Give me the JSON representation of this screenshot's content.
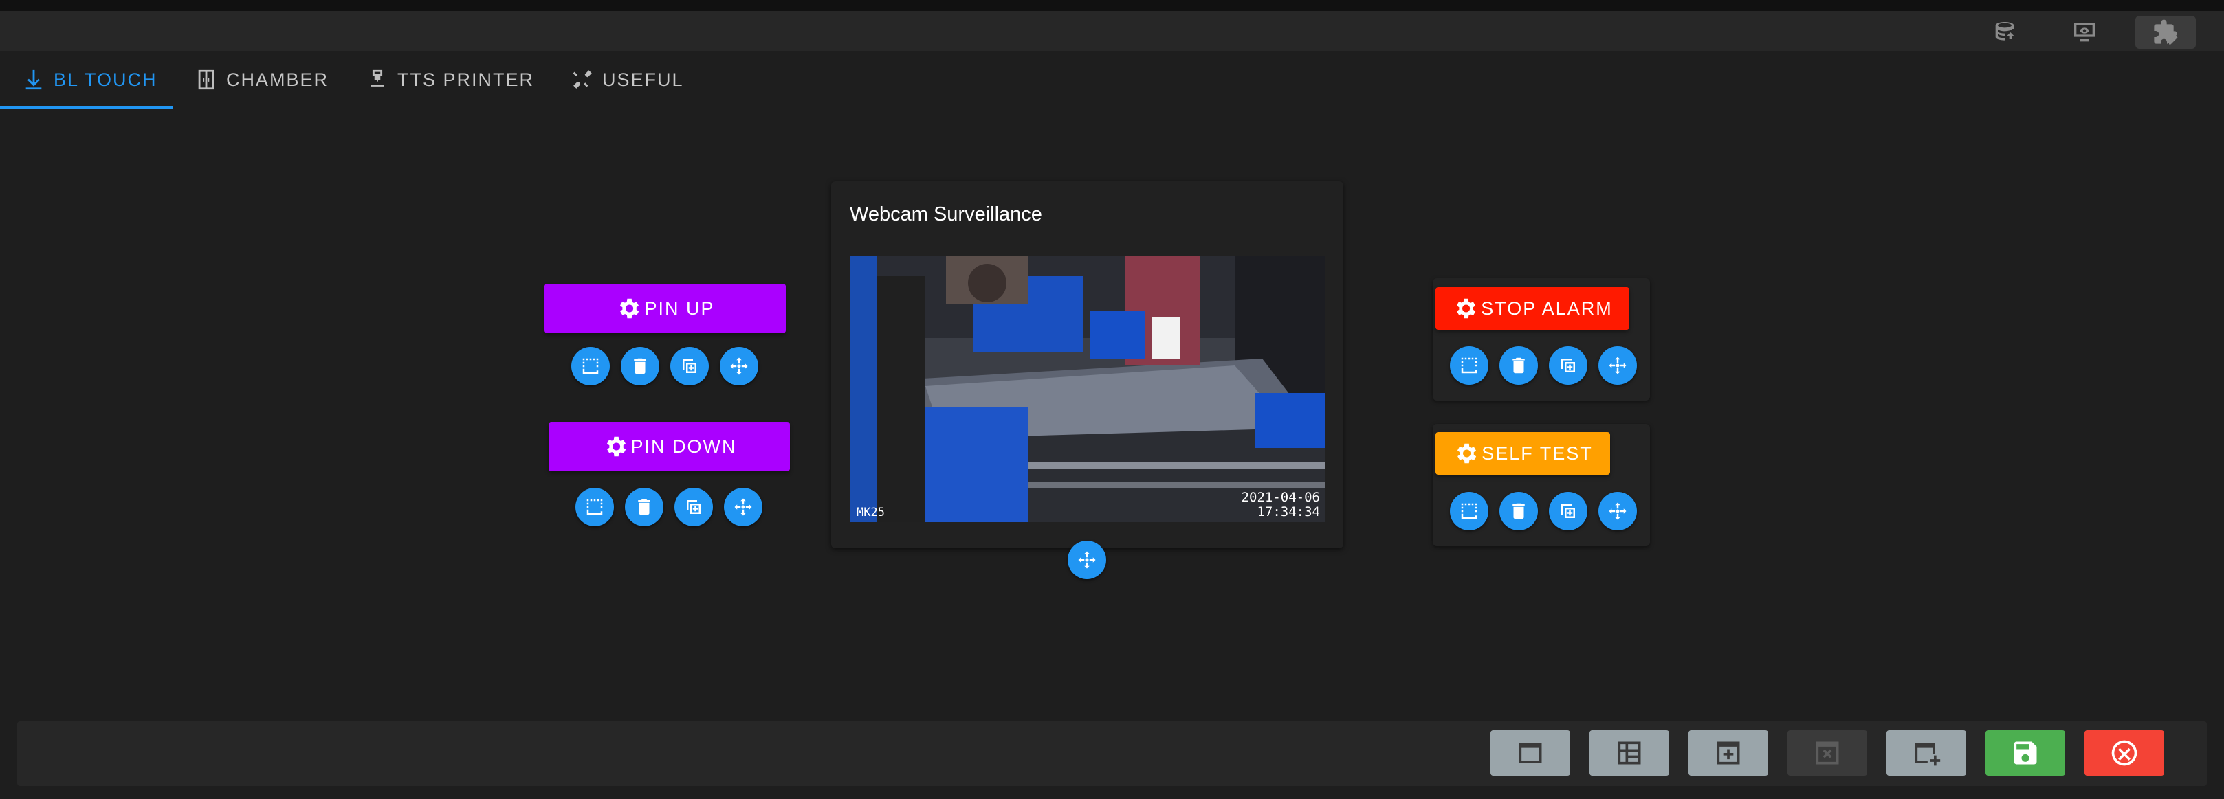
{
  "toolbar": {
    "icons": [
      "database-sync-icon",
      "monitor-eye-icon",
      "puzzle-edit-icon"
    ],
    "active_icon": "puzzle-edit-icon"
  },
  "tabs": [
    {
      "label": "BL TOUCH",
      "icon": "arrow-down-to-bed-icon",
      "active": true
    },
    {
      "label": "CHAMBER",
      "icon": "chamber-icon",
      "active": false
    },
    {
      "label": "TTS PRINTER",
      "icon": "printer-3d-nozzle-icon",
      "active": false
    },
    {
      "label": "USEFUL",
      "icon": "tools-icon",
      "active": false
    }
  ],
  "widgets": {
    "pin_up": {
      "label": "PIN UP",
      "color": "#aa00ff"
    },
    "pin_down": {
      "label": "PIN DOWN",
      "color": "#aa00ff"
    },
    "stop_alarm": {
      "label": "STOP ALARM",
      "color": "#ff1a00"
    },
    "self_test": {
      "label": "SELF TEST",
      "color": "#ffa000"
    }
  },
  "webcam": {
    "title": "Webcam Surveillance",
    "overlay_label": "MK25",
    "date": "2021-04-06",
    "time": "17:34:34"
  },
  "footer": {
    "buttons": [
      "add-panel-icon",
      "add-grid-icon",
      "add-box-icon",
      "remove-box-icon",
      "add-window-icon",
      "save-icon",
      "cancel-icon"
    ]
  },
  "colors": {
    "accent": "#2196f3",
    "background": "#1e1e1e",
    "save": "#4caf50",
    "cancel": "#f44336"
  }
}
